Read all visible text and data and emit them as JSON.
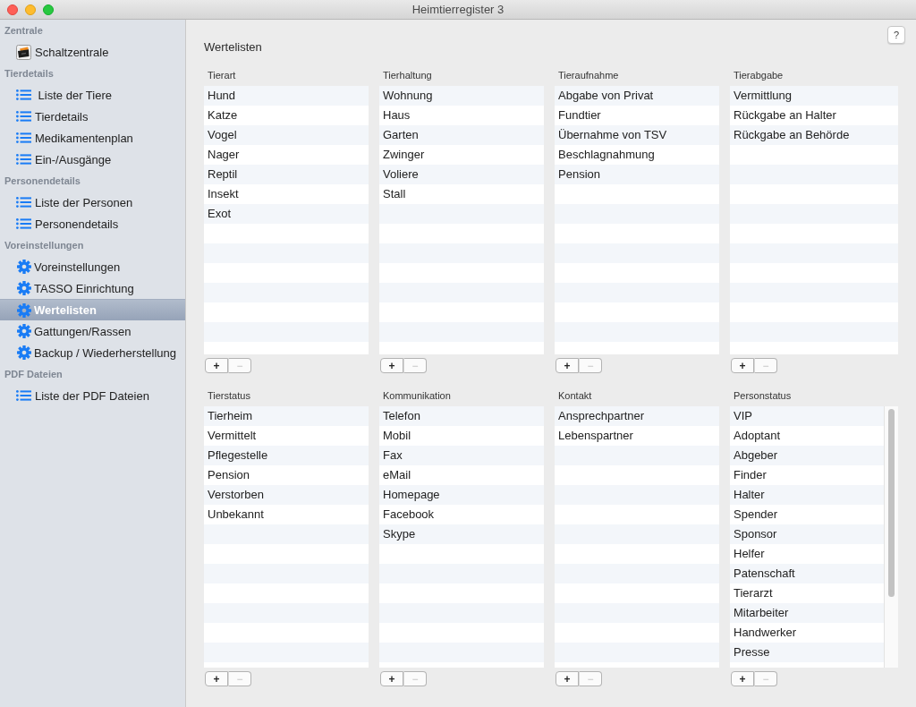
{
  "window": {
    "title": "Heimtierregister 3"
  },
  "sidebar": {
    "sections": [
      {
        "title": "Zentrale",
        "items": [
          {
            "label": "Schaltzentrale",
            "kind": "app",
            "selected": false
          }
        ]
      },
      {
        "title": "Tierdetails",
        "items": [
          {
            "label": " Liste der Tiere",
            "kind": "list",
            "selected": false
          },
          {
            "label": "Tierdetails",
            "kind": "list",
            "selected": false
          },
          {
            "label": "Medikamentenplan",
            "kind": "list",
            "selected": false
          },
          {
            "label": "Ein-/Ausgänge",
            "kind": "list",
            "selected": false
          }
        ]
      },
      {
        "title": "Personendetails",
        "items": [
          {
            "label": "Liste der Personen",
            "kind": "list",
            "selected": false
          },
          {
            "label": "Personendetails",
            "kind": "list",
            "selected": false
          }
        ]
      },
      {
        "title": "Voreinstellungen",
        "items": [
          {
            "label": "Voreinstellungen",
            "kind": "gear",
            "selected": false
          },
          {
            "label": "TASSO Einrichtung",
            "kind": "gear",
            "selected": false
          },
          {
            "label": "Wertelisten",
            "kind": "gear",
            "selected": true
          },
          {
            "label": "Gattungen/Rassen",
            "kind": "gear",
            "selected": false
          },
          {
            "label": "Backup / Wiederherstellung",
            "kind": "gear",
            "selected": false
          }
        ]
      },
      {
        "title": "PDF Dateien",
        "items": [
          {
            "label": "Liste der PDF Dateien",
            "kind": "list",
            "selected": false
          }
        ]
      }
    ]
  },
  "content": {
    "title": "Wertelisten",
    "help_button": "?",
    "lists": [
      {
        "title": "Tierart",
        "items": [
          "Hund",
          "Katze",
          "Vogel",
          "Nager",
          "Reptil",
          "Insekt",
          "Exot"
        ],
        "scrollable": false,
        "buttons": [
          {
            "label": "+",
            "disabled": false
          },
          {
            "label": "−",
            "disabled": true
          }
        ]
      },
      {
        "title": "Tierhaltung",
        "items": [
          "Wohnung",
          "Haus",
          "Garten",
          "Zwinger",
          "Voliere",
          "Stall"
        ],
        "scrollable": false,
        "buttons": [
          {
            "label": "+",
            "disabled": false
          },
          {
            "label": "−",
            "disabled": true
          }
        ]
      },
      {
        "title": "Tieraufnahme",
        "items": [
          "Abgabe von Privat",
          "Fundtier",
          "Übernahme von TSV",
          "Beschlagnahmung",
          "Pension"
        ],
        "scrollable": false,
        "buttons": [
          {
            "label": "+",
            "disabled": false
          },
          {
            "label": "−",
            "disabled": true
          }
        ]
      },
      {
        "title": "Tierabgabe",
        "items": [
          "Vermittlung",
          "Rückgabe an Halter",
          "Rückgabe an Behörde"
        ],
        "scrollable": false,
        "buttons": [
          {
            "label": "+",
            "disabled": false
          },
          {
            "label": "−",
            "disabled": true
          }
        ]
      },
      {
        "title": "Tierstatus",
        "items": [
          "Tierheim",
          "Vermittelt",
          "Pflegestelle",
          "Pension",
          "Verstorben",
          "Unbekannt"
        ],
        "scrollable": false,
        "buttons": [
          {
            "label": "+",
            "disabled": false
          },
          {
            "label": "−",
            "disabled": true
          }
        ]
      },
      {
        "title": "Kommunikation",
        "items": [
          "Telefon",
          "Mobil",
          "Fax",
          "eMail",
          "Homepage",
          "Facebook",
          "Skype"
        ],
        "scrollable": false,
        "buttons": [
          {
            "label": "+",
            "disabled": false
          },
          {
            "label": "−",
            "disabled": true
          }
        ]
      },
      {
        "title": "Kontakt",
        "items": [
          "Ansprechpartner",
          "Lebenspartner"
        ],
        "scrollable": false,
        "buttons": [
          {
            "label": "+",
            "disabled": false
          },
          {
            "label": "−",
            "disabled": true
          }
        ]
      },
      {
        "title": "Personstatus",
        "items": [
          "VIP",
          "Adoptant",
          "Abgeber",
          "Finder",
          "Halter",
          "Spender",
          "Sponsor",
          "Helfer",
          "Patenschaft",
          "Tierarzt",
          "Mitarbeiter",
          "Handwerker",
          "Presse"
        ],
        "scrollable": true,
        "buttons": [
          {
            "label": "+",
            "disabled": false
          },
          {
            "label": "−",
            "disabled": true
          }
        ]
      }
    ]
  }
}
